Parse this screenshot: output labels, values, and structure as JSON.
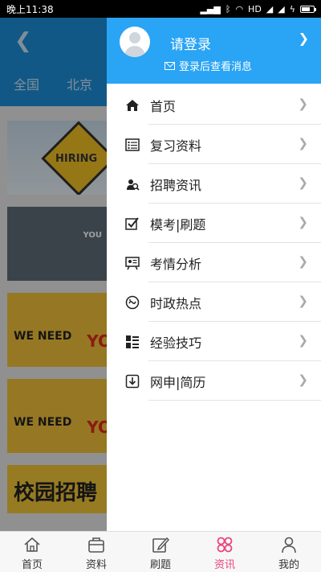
{
  "status_bar": {
    "time": "晚上11:38",
    "network": "HD",
    "battery_level": 0.7
  },
  "background_page": {
    "tabs": [
      "全国",
      "北京"
    ],
    "cards": [
      {
        "text": "HIRING"
      },
      {
        "text": "YOU"
      },
      {
        "text": "WE NEED",
        "extra": "YO"
      },
      {
        "text": "WE NEED",
        "extra": "YO"
      },
      {
        "text": "校园招聘"
      }
    ]
  },
  "drawer": {
    "login_title": "请登录",
    "login_subtitle": "登录后查看消息",
    "menu": [
      {
        "label": "首页",
        "icon": "home-icon"
      },
      {
        "label": "复习资料",
        "icon": "list-icon"
      },
      {
        "label": "招聘资讯",
        "icon": "person-search-icon"
      },
      {
        "label": "模考|刷题",
        "icon": "checkbox-icon"
      },
      {
        "label": "考情分析",
        "icon": "analysis-board-icon"
      },
      {
        "label": "时政热点",
        "icon": "news-icon"
      },
      {
        "label": "经验技巧",
        "icon": "grid-list-icon"
      },
      {
        "label": "网申|简历",
        "icon": "download-icon"
      }
    ]
  },
  "bottom_nav": {
    "items": [
      {
        "label": "首页",
        "icon": "home-icon"
      },
      {
        "label": "资料",
        "icon": "bag-icon"
      },
      {
        "label": "刷题",
        "icon": "edit-icon"
      },
      {
        "label": "资讯",
        "icon": "clover-icon"
      },
      {
        "label": "我的",
        "icon": "user-icon"
      }
    ],
    "active_index": 3,
    "active_color": "#e9467a"
  },
  "colors": {
    "header_blue": "#2aa4f4",
    "page_header_blue": "#1e8ed8"
  }
}
